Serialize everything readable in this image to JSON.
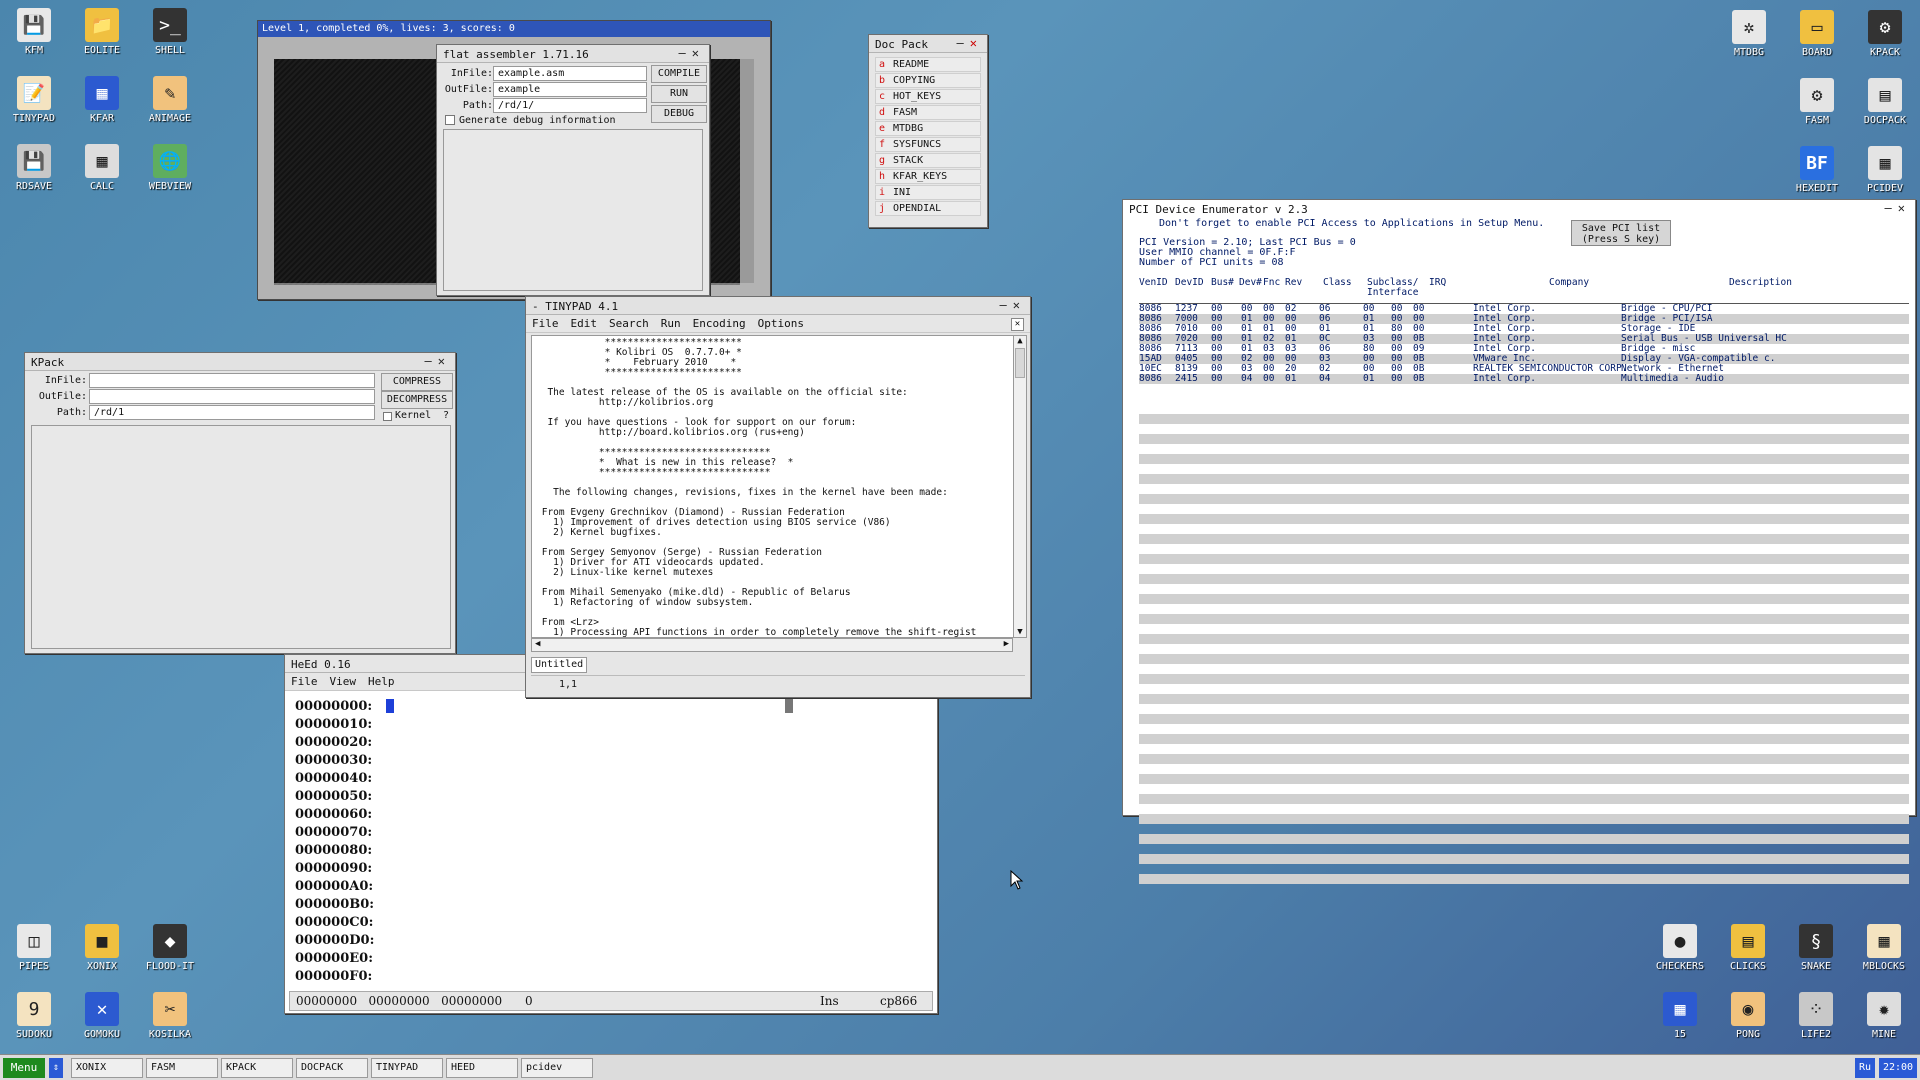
{
  "desktop": {
    "icons_left": [
      {
        "label": "KFM",
        "glyph": "💾"
      },
      {
        "label": "EOLITE",
        "glyph": "📁"
      },
      {
        "label": "SHELL",
        "glyph": ">_"
      },
      {
        "label": "TINYPAD",
        "glyph": "📝"
      },
      {
        "label": "KFAR",
        "glyph": "▦"
      },
      {
        "label": "ANIMAGE",
        "glyph": "✎"
      },
      {
        "label": "RDSAVE",
        "glyph": "💾"
      },
      {
        "label": "CALC",
        "glyph": "▦"
      },
      {
        "label": "WEBVIEW",
        "glyph": "🌐"
      }
    ],
    "icons_right": [
      {
        "label": "MTDBG",
        "glyph": "✲"
      },
      {
        "label": "BOARD",
        "glyph": "▭"
      },
      {
        "label": "KPACK",
        "glyph": "⚙"
      },
      {
        "label": "FASM",
        "glyph": "⚙"
      },
      {
        "label": "DOCPACK",
        "glyph": "▤"
      },
      {
        "label": "HEXEDIT",
        "glyph": "BF"
      },
      {
        "label": "PCIDEV",
        "glyph": "▦"
      }
    ],
    "games_left": [
      {
        "label": "PIPES",
        "glyph": "◫"
      },
      {
        "label": "XONIX",
        "glyph": "■"
      },
      {
        "label": "FLOOD-IT",
        "glyph": "◆"
      },
      {
        "label": "SUDOKU",
        "glyph": "9"
      },
      {
        "label": "GOMOKU",
        "glyph": "✕"
      },
      {
        "label": "KOSILKA",
        "glyph": "✂"
      }
    ],
    "games_right": [
      {
        "label": "CHECKERS",
        "glyph": "●"
      },
      {
        "label": "CLICKS",
        "glyph": "▤"
      },
      {
        "label": "SNAKE",
        "glyph": "§"
      },
      {
        "label": "MBLOCKS",
        "glyph": "▦"
      },
      {
        "label": "15",
        "glyph": "▦"
      },
      {
        "label": "PONG",
        "glyph": "◉"
      },
      {
        "label": "LIFE2",
        "glyph": "⁘"
      },
      {
        "label": "MINE",
        "glyph": "✹"
      }
    ]
  },
  "xonix": {
    "status": "Level 1, completed 0%, lives: 3, scores: 0"
  },
  "fasm": {
    "title": "flat assembler 1.71.16",
    "infile_label": "InFile:",
    "infile": "example.asm",
    "outfile_label": "OutFile:",
    "outfile": "example",
    "path_label": "Path:",
    "path": "/rd/1/",
    "compile": "COMPILE",
    "run": "RUN",
    "debug": "DEBUG",
    "debug_info": "Generate debug information"
  },
  "docpack": {
    "title": "Doc Pack",
    "items": [
      {
        "key": "a",
        "name": "README"
      },
      {
        "key": "b",
        "name": "COPYING"
      },
      {
        "key": "c",
        "name": "HOT_KEYS"
      },
      {
        "key": "d",
        "name": "FASM"
      },
      {
        "key": "e",
        "name": "MTDBG"
      },
      {
        "key": "f",
        "name": "SYSFUNCS"
      },
      {
        "key": "g",
        "name": "STACK"
      },
      {
        "key": "h",
        "name": "KFAR_KEYS"
      },
      {
        "key": "i",
        "name": "INI"
      },
      {
        "key": "j",
        "name": "OPENDIAL"
      }
    ]
  },
  "kpack": {
    "title": "KPack",
    "infile_label": "InFile:",
    "outfile_label": "OutFile:",
    "path_label": "Path:",
    "path": "/rd/1",
    "compress": "COMPRESS",
    "decompress": "DECOMPRESS",
    "kernel": "Kernel",
    "help": "?"
  },
  "tinypad": {
    "title": "- TINYPAD 4.1",
    "menu": [
      "File",
      "Edit",
      "Search",
      "Run",
      "Encoding",
      "Options"
    ],
    "text": "            ************************\n            * Kolibri OS  0.7.7.0+ *\n            *    February 2010    *\n            ************************\n\n  The latest release of the OS is available on the official site:\n           http://kolibrios.org\n\n  If you have questions - look for support on our forum:\n           http://board.kolibrios.org (rus+eng)\n\n           ******************************\n           *  What is new in this release?  *\n           ******************************\n\n   The following changes, revisions, fixes in the kernel have been made:\n\n From Evgeny Grechnikov (Diamond) - Russian Federation\n   1) Improvement of drives detection using BIOS service (V86)\n   2) Kernel bugfixes.\n\n From Sergey Semyonov (Serge) - Russian Federation\n   1) Driver for ATI videocards updated.\n   2) Linux-like kernel mutexes\n\n From Mihail Semenyako (mike.dld) - Republic of Belarus\n   1) Refactoring of window subsystem.\n\n From <Lrz>\n   1) Processing API functions in order to completely remove the shift-regist",
    "tab": "Untitled",
    "position": "1,1"
  },
  "heed": {
    "title": "HeEd 0.16",
    "menu": [
      "File",
      "View",
      "Help"
    ],
    "rows": [
      "00000000:",
      "00000010:",
      "00000020:",
      "00000030:",
      "00000040:",
      "00000050:",
      "00000060:",
      "00000070:",
      "00000080:",
      "00000090:",
      "000000A0:",
      "000000B0:",
      "000000C0:",
      "000000D0:",
      "000000E0:",
      "000000F0:"
    ],
    "status": [
      "00000000",
      "00000000",
      "00000000",
      "0"
    ],
    "mode": "Ins",
    "codepage": "cp866"
  },
  "pcidev": {
    "title": "PCI Device Enumerator v 2.3",
    "notice": "Don't forget to enable PCI Access to Applications in Setup Menu.",
    "save_btn": "Save PCI list\n(Press S key)",
    "info": [
      "PCI Version  = 2.10; Last PCI Bus = 0",
      "User MMIO channel = 0F.F:F",
      "Number of PCI units = 08"
    ],
    "headers": [
      "VenID",
      "DevID",
      "Bus#",
      "Dev#",
      "Fnc",
      "Rev",
      "Class",
      "Subclass/\nInterface",
      "IRQ",
      "Company",
      "Description"
    ],
    "rows": [
      [
        "8086",
        "1237",
        "00",
        "00",
        "00",
        "02",
        "06",
        "00",
        "00",
        "00",
        "Intel Corp.",
        "Bridge - CPU/PCI"
      ],
      [
        "8086",
        "7000",
        "00",
        "01",
        "00",
        "00",
        "06",
        "01",
        "00",
        "00",
        "Intel Corp.",
        "Bridge - PCI/ISA"
      ],
      [
        "8086",
        "7010",
        "00",
        "01",
        "01",
        "00",
        "01",
        "01",
        "80",
        "00",
        "Intel Corp.",
        "Storage - IDE"
      ],
      [
        "8086",
        "7020",
        "00",
        "01",
        "02",
        "01",
        "0C",
        "03",
        "00",
        "0B",
        "Intel Corp.",
        "Serial Bus - USB Universal HC"
      ],
      [
        "8086",
        "7113",
        "00",
        "01",
        "03",
        "03",
        "06",
        "80",
        "00",
        "09",
        "Intel Corp.",
        "Bridge - misc"
      ],
      [
        "15AD",
        "0405",
        "00",
        "02",
        "00",
        "00",
        "03",
        "00",
        "00",
        "0B",
        "VMware Inc.",
        "Display - VGA-compatible c."
      ],
      [
        "10EC",
        "8139",
        "00",
        "03",
        "00",
        "20",
        "02",
        "00",
        "00",
        "0B",
        "REALTEK SEMICONDUCTOR CORP.",
        "Network - Ethernet"
      ],
      [
        "8086",
        "2415",
        "00",
        "04",
        "00",
        "01",
        "04",
        "01",
        "00",
        "0B",
        "Intel Corp.",
        "Multimedia - Audio"
      ]
    ]
  },
  "taskbar": {
    "menu": "Menu",
    "arrow": "⇕",
    "tasks": [
      "XONIX",
      "FASM",
      "KPACK",
      "DOCPACK",
      "TINYPAD",
      "HEED",
      "pcidev"
    ],
    "lang": "Ru",
    "clock": "22:00"
  }
}
